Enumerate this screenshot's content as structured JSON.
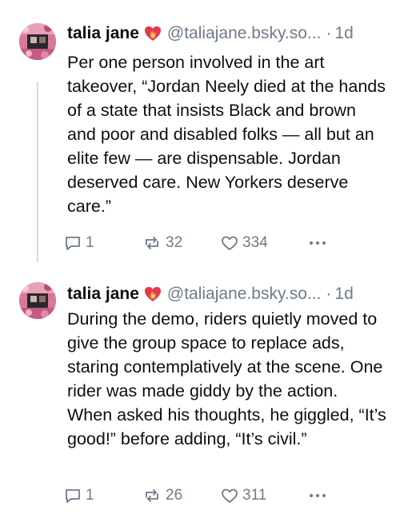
{
  "colors": {
    "text": "#0b0f14",
    "muted": "#6f7b89",
    "heart": "#e8374e",
    "thread_line": "#d4dbe2"
  },
  "posts": [
    {
      "display_name": "talia jane",
      "badge_icon": "heart-on-fire-icon",
      "handle": "@taliajane.bsky.so...",
      "separator": "·",
      "time": "1d",
      "text": "Per one person involved in the art takeover, “Jordan Neely died at the hands of a state that insists Black and brown and poor and disabled folks — all but an elite few — are dispensable. Jordan deserved care. New Yorkers deserve care.”",
      "replies": "1",
      "reposts": "32",
      "likes": "334"
    },
    {
      "display_name": "talia jane",
      "badge_icon": "heart-on-fire-icon",
      "handle": "@taliajane.bsky.so...",
      "separator": "·",
      "time": "1d",
      "text": "During the demo, riders quietly moved to give the group space to replace ads, staring contemplatively at the scene. One rider was made giddy by the action. When asked his thoughts, he giggled, “It’s good!” before adding, “It’s civil.”",
      "replies": "1",
      "reposts": "26",
      "likes": "311"
    }
  ]
}
